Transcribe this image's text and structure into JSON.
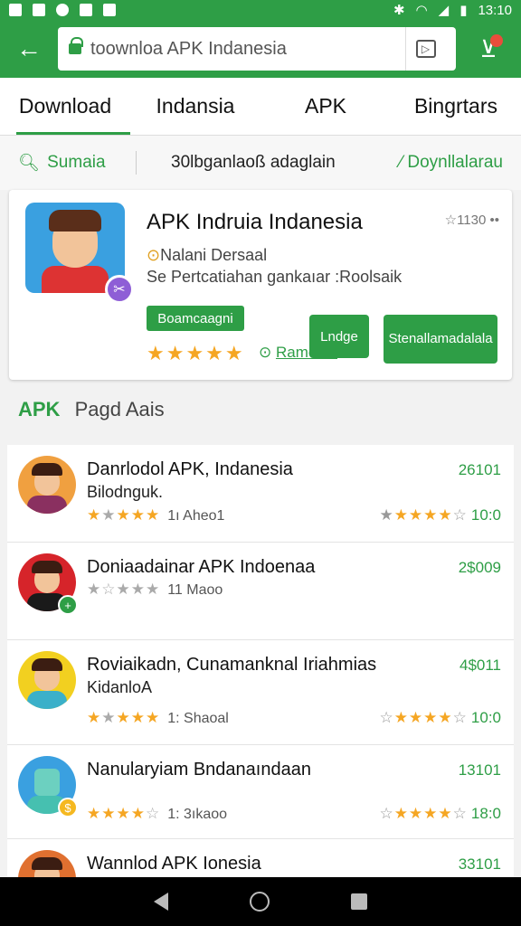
{
  "status_bar": {
    "time": "13:10"
  },
  "url_bar": {
    "url": "toownloa APK Indanesia"
  },
  "tabs": [
    {
      "label": "Download"
    },
    {
      "label": "Indansia"
    },
    {
      "label": "APK"
    },
    {
      "label": "Bingrtars"
    }
  ],
  "filters": {
    "search_label": "Sumaia",
    "middle_label": "30lbganlaoß adaglain",
    "right_label": "Doynllalarau"
  },
  "featured": {
    "title": "APK Indruia Indanesia",
    "meta": "☆1130 ••",
    "subtitle1": "Nalani Dersaal",
    "subtitle2": "Se Pertcatiahan gankaıar :Roolsaik",
    "chip": "Boamcaagni",
    "stars": "★★★★★",
    "link": "Ramo ak",
    "button1": "Lndge",
    "button2_line1": "Stenallamada",
    "button2_line2": "lala"
  },
  "section": {
    "tag": "APK",
    "title": "Pagd Aais"
  },
  "apps": [
    {
      "name": "Danrlodol APK, Indanesia",
      "name2": "Bilodnguk.",
      "rating": "1ı Aheo1",
      "version": "26101",
      "score": "10:0"
    },
    {
      "name": "Doniaadainar APK Indoenaa",
      "name2": "",
      "rating": "11 Maoo",
      "version": "2$009",
      "score": ""
    },
    {
      "name": "Roviaikadn, Cunamanknal Iriahmias",
      "name2": "KidanloA",
      "rating": "1: Shaoal",
      "version": "4$011",
      "score": "10:0"
    },
    {
      "name": "Nanularyiam Bndanaındaan",
      "name2": "",
      "rating": "1: 3ıkaoo",
      "version": "13101",
      "score": "18:0"
    },
    {
      "name": "Wannlod APK Ionesia",
      "name2": "",
      "rating": "",
      "version": "33101",
      "score": ""
    }
  ]
}
